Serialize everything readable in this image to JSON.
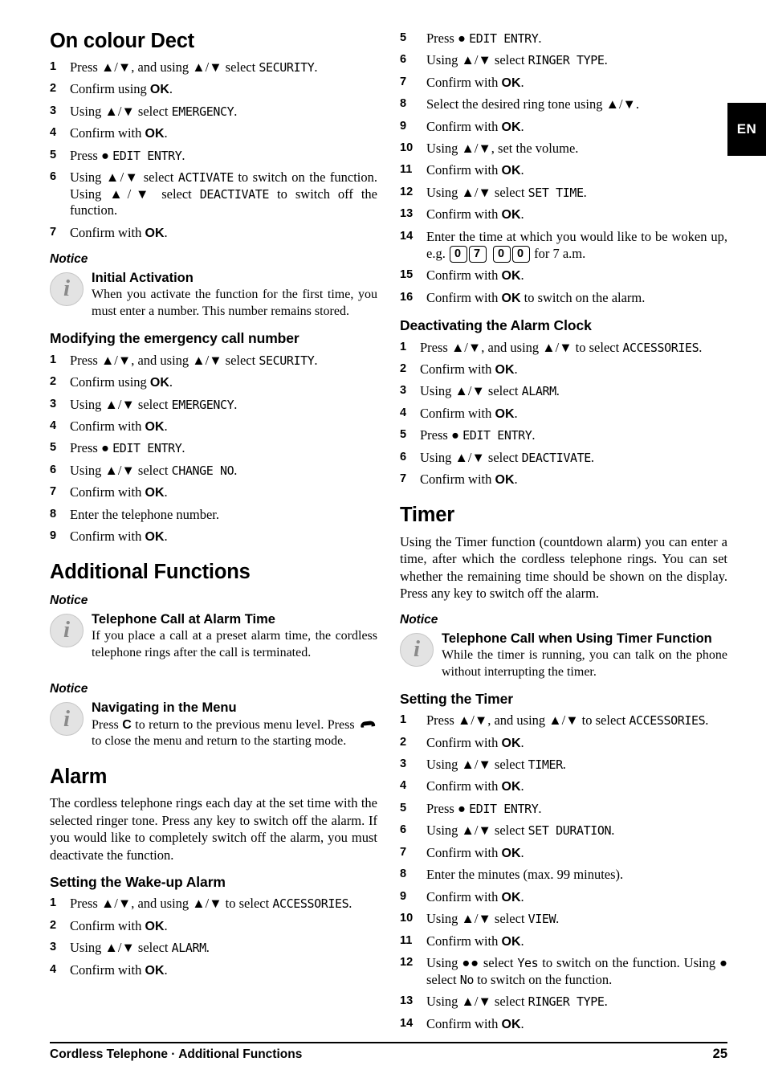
{
  "language_tab": "EN",
  "footer": {
    "text": "Cordless Telephone  ·  Additional Functions",
    "page_number": "25"
  },
  "left_column": {
    "heading": "On colour Dect",
    "steps_on_colour_dect": [
      {
        "num": "1",
        "pre": "Press ▲/▼, and using ▲/▼ select ",
        "lcd": "SECURITY",
        "post": "."
      },
      {
        "num": "2",
        "pre": "Confirm using ",
        "ok": "OK",
        "post": "."
      },
      {
        "num": "3",
        "pre": "Using ▲/▼ select ",
        "lcd": "EMERGENCY",
        "post": "."
      },
      {
        "num": "4",
        "pre": "Confirm with ",
        "ok": "OK",
        "post": "."
      },
      {
        "num": "5",
        "pre": "Press ● ",
        "lcd": "EDIT ENTRY",
        "post": "."
      },
      {
        "num": "6",
        "pre": "Using ▲/▼ select ",
        "lcd": "ACTIVATE",
        "mid": " to switch on the function. Using ▲/▼ select ",
        "lcd2": "DEACTIVATE",
        "post": " to switch off the function."
      },
      {
        "num": "7",
        "pre": "Confirm with ",
        "ok": "OK",
        "post": "."
      }
    ],
    "notice_label_1": "Notice",
    "notice_1": {
      "title": "Initial Activation",
      "text": "When you activate the function for the first time, you must enter a number. This number remains stored."
    },
    "heading_modify": "Modifying the emergency call number",
    "steps_modify": [
      {
        "num": "1",
        "pre": "Press ▲/▼, and using ▲/▼ select ",
        "lcd": "SECURITY",
        "post": "."
      },
      {
        "num": "2",
        "pre": "Confirm using ",
        "ok": "OK",
        "post": "."
      },
      {
        "num": "3",
        "pre": "Using ▲/▼ select ",
        "lcd": "EMERGENCY",
        "post": "."
      },
      {
        "num": "4",
        "pre": "Confirm with ",
        "ok": "OK",
        "post": "."
      },
      {
        "num": "5",
        "pre": "Press ● ",
        "lcd": "EDIT ENTRY",
        "post": "."
      },
      {
        "num": "6",
        "pre": "Using ▲/▼ select ",
        "lcd": "CHANGE NO",
        "post": "."
      },
      {
        "num": "7",
        "pre": "Confirm with ",
        "ok": "OK",
        "post": "."
      },
      {
        "num": "8",
        "pre": "Enter the telephone number.",
        "post": ""
      },
      {
        "num": "9",
        "pre": "Confirm with ",
        "ok": "OK",
        "post": "."
      }
    ],
    "heading_additional": "Additional Functions",
    "notice_label_2": "Notice",
    "notice_2": {
      "title": "Telephone Call at Alarm Time",
      "text": "If you place a call at a preset alarm time, the cordless telephone rings after the call is terminated."
    },
    "notice_label_3": "Notice",
    "notice_3": {
      "title": "Navigating in the Menu",
      "text_a": "Press ",
      "key_c": "C",
      "text_b": " to return to the previous menu level. Press ",
      "text_c": " to close the menu and return to the starting mode."
    },
    "heading_alarm": "Alarm",
    "alarm_paragraph": "The cordless telephone rings each day at the set time with the selected ringer tone. Press any key to switch off the alarm. If you would like to completely switch off the alarm, you must deactivate the function.",
    "heading_wakeup": "Setting the Wake-up Alarm",
    "steps_wakeup": [
      {
        "num": "1",
        "pre": "Press ▲/▼, and using ▲/▼ to select ",
        "lcd": "ACCESSORIES",
        "post": "."
      },
      {
        "num": "2",
        "pre": " Confirm with ",
        "ok": "OK",
        "post": "."
      },
      {
        "num": "3",
        "pre": "Using ▲/▼ select ",
        "lcd": "ALARM",
        "post": "."
      },
      {
        "num": "4",
        "pre": "Confirm with ",
        "ok": "OK",
        "post": "."
      }
    ]
  },
  "right_column": {
    "steps_wakeup_cont": [
      {
        "num": "5",
        "pre": "Press ● ",
        "lcd": "EDIT ENTRY",
        "post": "."
      },
      {
        "num": "6",
        "pre": "Using ▲/▼ select ",
        "lcd": "RINGER TYPE",
        "post": "."
      },
      {
        "num": "7",
        "pre": "Confirm with ",
        "ok": "OK",
        "post": "."
      },
      {
        "num": "8",
        "pre": "Select the desired ring tone using ▲/▼.",
        "post": ""
      },
      {
        "num": "9",
        "pre": "Confirm with ",
        "ok": "OK",
        "post": "."
      },
      {
        "num": "10",
        "pre": "Using ▲/▼, set the volume.",
        "post": ""
      },
      {
        "num": "11",
        "pre": "Confirm with ",
        "ok": "OK",
        "post": "."
      },
      {
        "num": "12",
        "pre": "Using ▲/▼ select ",
        "lcd": "SET TIME",
        "post": "."
      },
      {
        "num": "13",
        "pre": "Confirm with ",
        "ok": "OK",
        "post": "."
      },
      {
        "num": "14",
        "pre": "Enter the time at which you would like to be woken up, e.g. ",
        "keys": [
          "0",
          "7",
          "0",
          "0"
        ],
        "post": " for 7 a.m."
      },
      {
        "num": "15",
        "pre": "Confirm with ",
        "ok": "OK",
        "post": "."
      },
      {
        "num": "16",
        "pre": "Confirm with ",
        "ok": "OK",
        "post": " to switch on the alarm."
      }
    ],
    "heading_deactivating": "Deactivating the Alarm Clock",
    "steps_deactivating": [
      {
        "num": "1",
        "pre": "Press ▲/▼, and using ▲/▼ to select ",
        "lcd": "ACCESSORIES",
        "post": "."
      },
      {
        "num": "2",
        "pre": " Confirm with ",
        "ok": "OK",
        "post": "."
      },
      {
        "num": "3",
        "pre": "Using ▲/▼ select ",
        "lcd": "ALARM",
        "post": "."
      },
      {
        "num": "4",
        "pre": "Confirm with ",
        "ok": "OK",
        "post": "."
      },
      {
        "num": "5",
        "pre": "Press ● ",
        "lcd": "EDIT ENTRY",
        "post": "."
      },
      {
        "num": "6",
        "pre": "Using ▲/▼ select ",
        "lcd": "DEACTIVATE",
        "post": "."
      },
      {
        "num": "7",
        "pre": "Confirm with ",
        "ok": "OK",
        "post": "."
      }
    ],
    "heading_timer": "Timer",
    "timer_paragraph": "Using the Timer function (countdown alarm) you can enter a time, after which the cordless telephone rings. You can set whether the remaining time should be shown on the display. Press any key to switch off the alarm.",
    "notice_label": "Notice",
    "notice": {
      "title": "Telephone Call when Using Timer Function",
      "text": "While the timer is running, you can talk on the phone without interrupting the timer."
    },
    "heading_setting_timer": "Setting the Timer",
    "steps_timer": [
      {
        "num": "1",
        "pre": "Press ▲/▼, and using ▲/▼ to select ",
        "lcd": "ACCESSORIES",
        "post": "."
      },
      {
        "num": "2",
        "pre": " Confirm with ",
        "ok": "OK",
        "post": "."
      },
      {
        "num": "3",
        "pre": "Using ▲/▼ select ",
        "lcd": "TIMER",
        "post": "."
      },
      {
        "num": "4",
        "pre": "Confirm with ",
        "ok": "OK",
        "post": "."
      },
      {
        "num": "5",
        "pre": "Press ● ",
        "lcd": "EDIT ENTRY",
        "post": "."
      },
      {
        "num": "6",
        "pre": "Using ▲/▼ select ",
        "lcd": "SET DURATION",
        "post": "."
      },
      {
        "num": "7",
        "pre": "Confirm with ",
        "ok": "OK",
        "post": "."
      },
      {
        "num": "8",
        "pre": "Enter the minutes (max. 99 minutes).",
        "post": ""
      },
      {
        "num": "9",
        "pre": "Confirm with ",
        "ok": "OK",
        "post": "."
      },
      {
        "num": "10",
        "pre": "Using ▲/▼ select ",
        "lcd": "VIEW",
        "post": "."
      },
      {
        "num": "11",
        "pre": "Confirm with ",
        "ok": "OK",
        "post": "."
      },
      {
        "num": "12",
        "pre": "Using ●● select ",
        "lcd": "Yes",
        "mid": " to switch on the function. Using ● select ",
        "lcd2": "No",
        "post": " to switch on the function."
      },
      {
        "num": "13",
        "pre": "Using ▲/▼ select ",
        "lcd": "RINGER TYPE",
        "post": "."
      },
      {
        "num": "14",
        "pre": "Confirm with ",
        "ok": "OK",
        "post": "."
      }
    ]
  }
}
